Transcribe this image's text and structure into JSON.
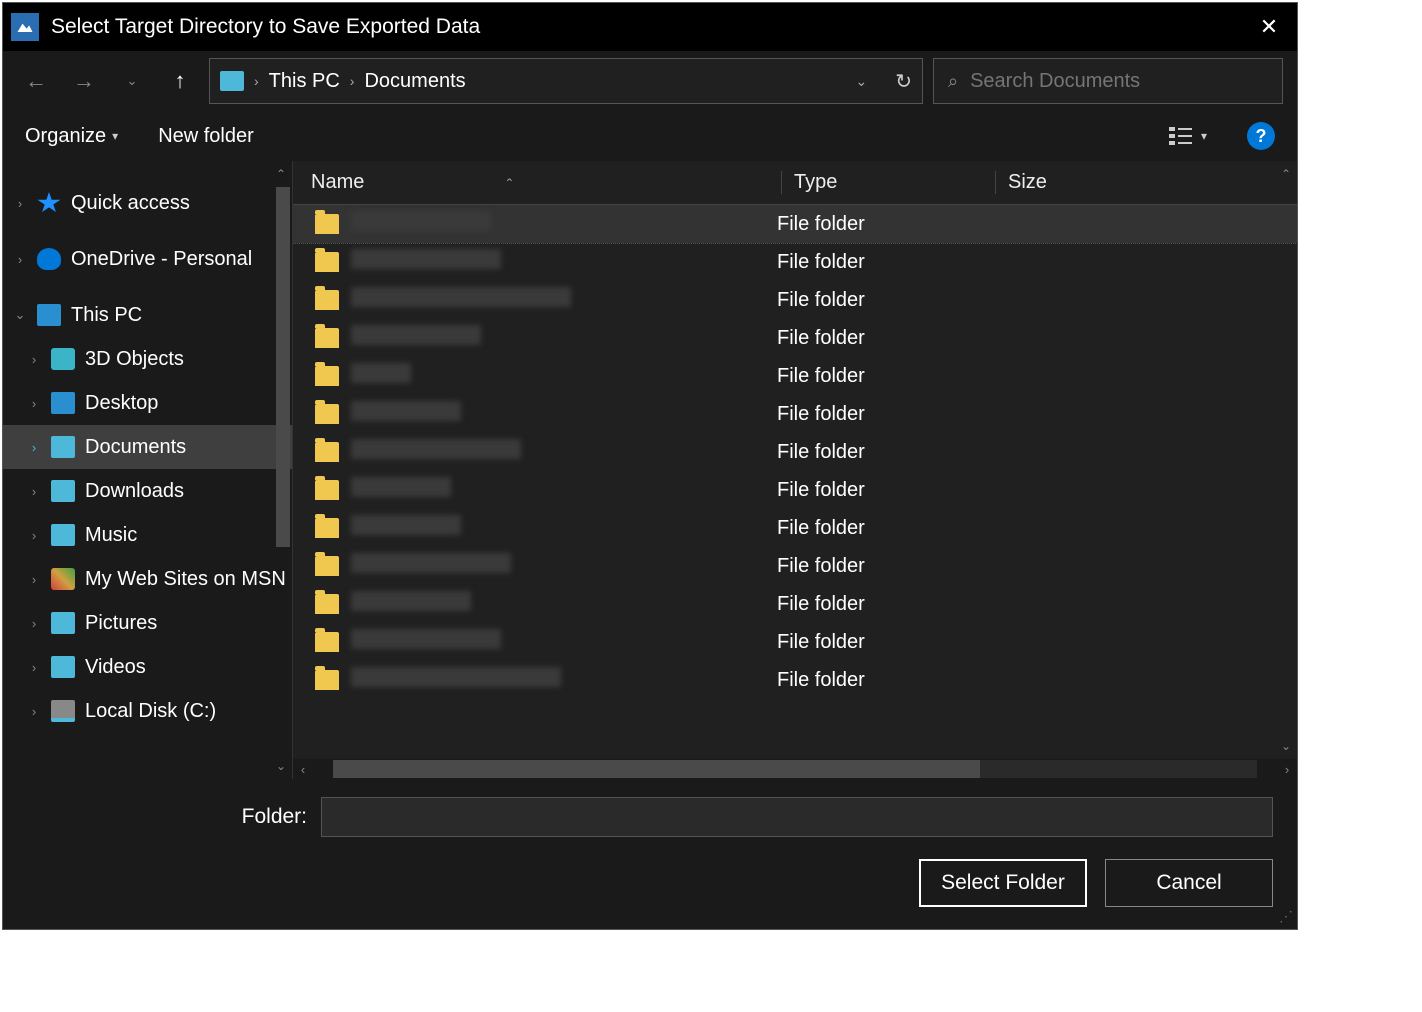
{
  "title": "Select Target Directory to Save Exported Data",
  "breadcrumbs": {
    "root": "This PC",
    "current": "Documents"
  },
  "search": {
    "placeholder": "Search Documents"
  },
  "toolbar": {
    "organize": "Organize",
    "newfolder": "New folder"
  },
  "columns": {
    "name": "Name",
    "type": "Type",
    "size": "Size"
  },
  "sidebar": {
    "quick": "Quick access",
    "onedrive": "OneDrive - Personal",
    "thispc": "This PC",
    "items": [
      {
        "label": "3D Objects",
        "icon": "cube"
      },
      {
        "label": "Desktop",
        "icon": "desktop"
      },
      {
        "label": "Documents",
        "icon": "doc"
      },
      {
        "label": "Downloads",
        "icon": "down"
      },
      {
        "label": "Music",
        "icon": "music"
      },
      {
        "label": "My Web Sites on MSN",
        "icon": "web"
      },
      {
        "label": "Pictures",
        "icon": "pic"
      },
      {
        "label": "Videos",
        "icon": "vid"
      },
      {
        "label": "Local Disk (C:)",
        "icon": "disk"
      }
    ],
    "selected_index": 2
  },
  "file_type_label": "File folder",
  "files": [
    {
      "blur_w": 140
    },
    {
      "blur_w": 150
    },
    {
      "blur_w": 220
    },
    {
      "blur_w": 130
    },
    {
      "blur_w": 60
    },
    {
      "blur_w": 110
    },
    {
      "blur_w": 170
    },
    {
      "blur_w": 100
    },
    {
      "blur_w": 110
    },
    {
      "blur_w": 160
    },
    {
      "blur_w": 120
    },
    {
      "blur_w": 150
    },
    {
      "blur_w": 210
    }
  ],
  "footer": {
    "folder_label": "Folder:",
    "folder_value": "",
    "select": "Select Folder",
    "cancel": "Cancel"
  }
}
